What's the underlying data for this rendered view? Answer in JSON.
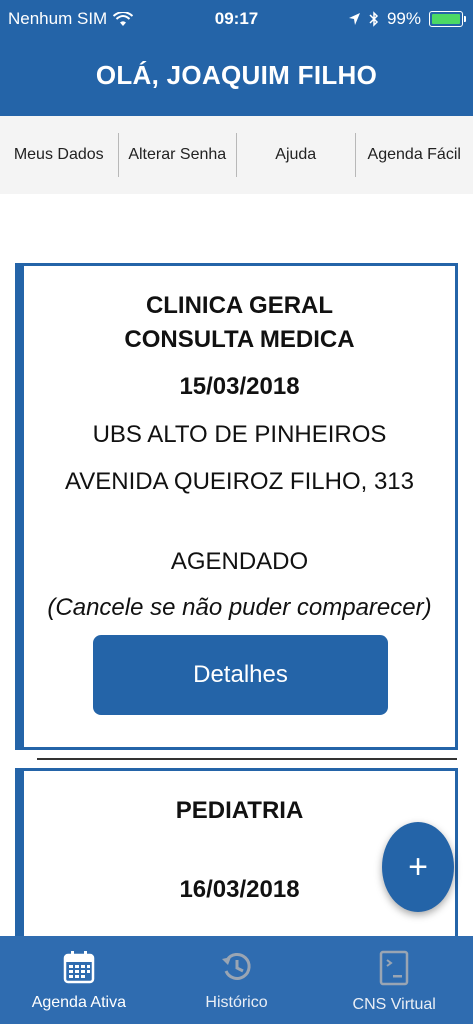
{
  "status_bar": {
    "carrier": "Nenhum SIM",
    "time": "09:17",
    "battery": "99%",
    "battery_level": 0.99
  },
  "header": {
    "greeting": "OLÁ, JOAQUIM FILHO"
  },
  "menu": {
    "items": [
      "Meus Dados",
      "Alterar Senha",
      "Ajuda",
      "Agenda Fácil"
    ]
  },
  "appointments": [
    {
      "specialty": "CLINICA GERAL",
      "type": "CONSULTA MEDICA",
      "date": "15/03/2018",
      "unit": "UBS ALTO DE PINHEIROS",
      "address": "AVENIDA QUEIROZ FILHO, 313",
      "status": "AGENDADO",
      "note": "(Cancele se não puder comparecer)",
      "details_label": "Detalhes"
    },
    {
      "specialty": "PEDIATRIA",
      "date": "16/03/2018"
    }
  ],
  "fab": {
    "label": "+"
  },
  "tabbar": {
    "tabs": [
      {
        "label": "Agenda Ativa",
        "icon": "calendar-icon",
        "active": true
      },
      {
        "label": "Histórico",
        "icon": "history-icon",
        "active": false
      },
      {
        "label": "CNS Virtual",
        "icon": "card-icon",
        "active": false
      }
    ]
  },
  "colors": {
    "primary": "#2464a8",
    "tabbar": "#2f6cb0",
    "battery": "#4cd964"
  }
}
